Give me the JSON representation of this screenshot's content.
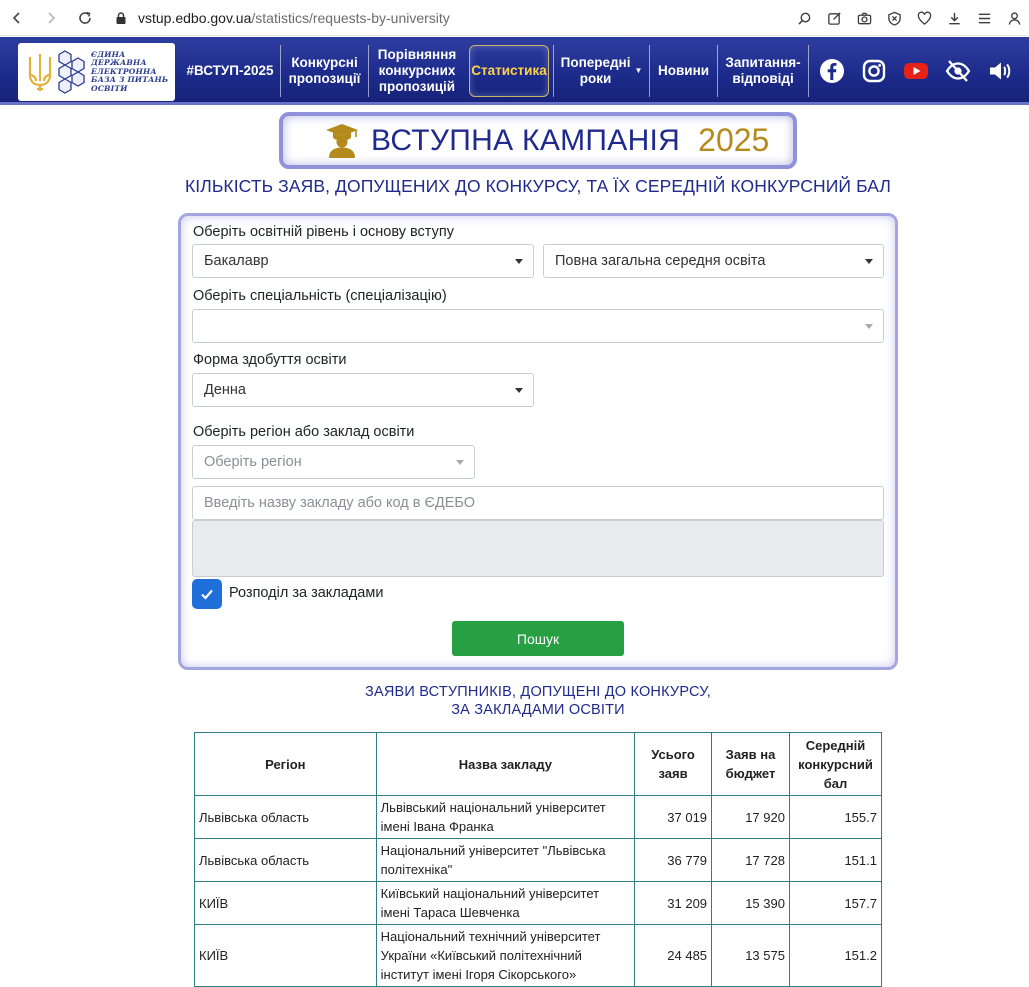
{
  "browser": {
    "domain": "vstup.edbo.gov.ua",
    "path": "/statistics/requests-by-university"
  },
  "header": {
    "logo_lines": [
      "ЄДИНА",
      "ДЕРЖАВНА",
      "ЕЛЕКТРОННА",
      "БАЗА З ПИТАНЬ",
      "ОСВІТИ"
    ],
    "menu": [
      {
        "label": "#ВСТУП-2025"
      },
      {
        "label": "Конкурсні пропозиції"
      },
      {
        "label": "Порівняння конкурсних пропозицій"
      },
      {
        "label": "Статистика"
      },
      {
        "label": "Попередні роки"
      },
      {
        "label": "Новини"
      },
      {
        "label": "Запитання-відповіді"
      }
    ],
    "accent_color": "#ffd24a"
  },
  "banner": {
    "title": "ВСТУПНА КАМПАНІЯ",
    "year": "2025"
  },
  "page_heading": "КІЛЬКІСТЬ ЗАЯВ, ДОПУЩЕНИХ ДО КОНКУРСУ, ТА ЇХ СЕРЕДНІЙ КОНКУРСНИЙ БАЛ",
  "form": {
    "level_label": "Оберіть освітній рівень і основу вступу",
    "level_value": "Бакалавр",
    "basis_value": "Повна загальна середня освіта",
    "specialty_label": "Оберіть спеціальність (спеціалізацію)",
    "specialty_value": "",
    "study_form_label": "Форма здобуття освіти",
    "study_form_value": "Денна",
    "region_label": "Оберіть регіон або заклад освіти",
    "region_placeholder": "Оберіть регіон",
    "institution_placeholder": "Введіть назву закладу або код в ЄДЕБО",
    "split_label": "Розподіл за закладами",
    "search_label": "Пошук",
    "button_color": "#26a043"
  },
  "results": {
    "title_line1": "ЗАЯВИ ВСТУПНИКІВ, ДОПУЩЕНІ ДО КОНКУРСУ,",
    "title_line2": "ЗА ЗАКЛАДАМИ ОСВІТИ",
    "columns": [
      "Регіон",
      "Назва закладу",
      "Усього заяв",
      "Заяв на бюджет",
      "Середній конкурсний бал"
    ],
    "rows": [
      {
        "region": "Львівська область",
        "name": "Львівський національний університет імені Івана Франка",
        "total": "37 019",
        "budget": "17 920",
        "score": "155.7"
      },
      {
        "region": "Львівська область",
        "name": "Національний університет \"Львівська політехніка\"",
        "total": "36 779",
        "budget": "17 728",
        "score": "151.1"
      },
      {
        "region": "КИЇВ",
        "name": "Київський національний університет імені Тараса Шевченка",
        "total": "31 209",
        "budget": "15 390",
        "score": "157.7"
      },
      {
        "region": "КИЇВ",
        "name": "Національний технічний університет України «Київський політехнічний інститут імені Ігоря Сікорського»",
        "total": "24 485",
        "budget": "13 575",
        "score": "151.2"
      }
    ]
  }
}
